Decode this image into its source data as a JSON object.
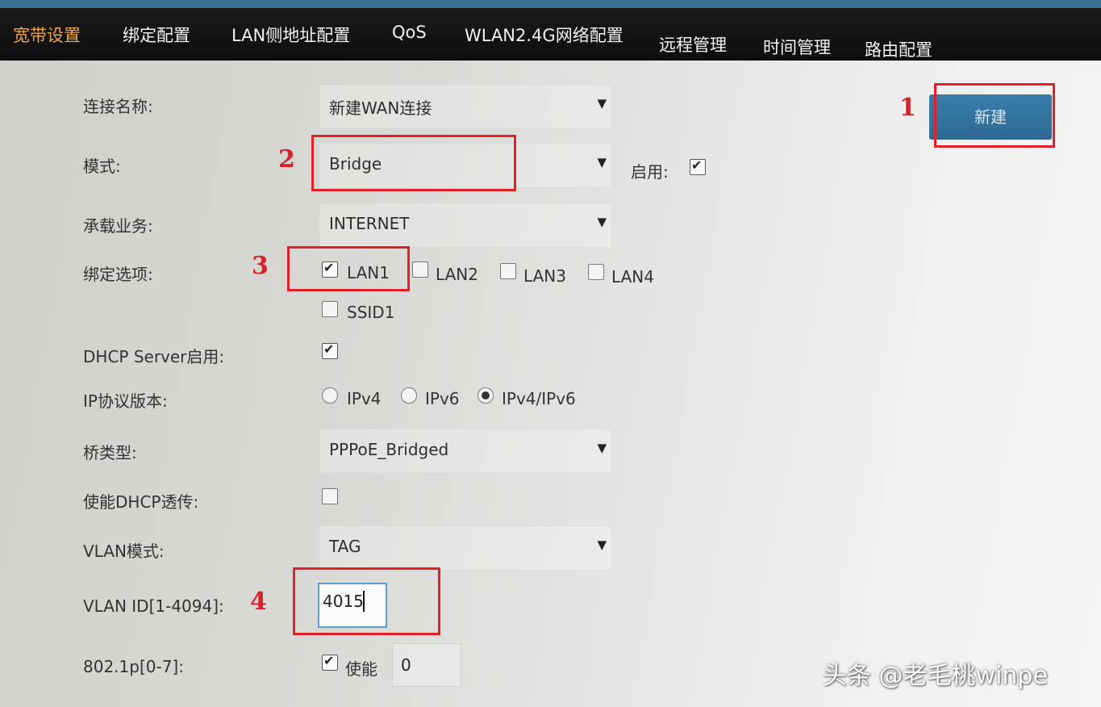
{
  "navbar": {
    "items": [
      "宽带设置",
      "绑定配置",
      "LAN侧地址配置",
      "QoS",
      "WLAN2.4G网络配置",
      "远程管理",
      "时间管理",
      "路由配置"
    ],
    "active_index": 0
  },
  "form": {
    "connection_name": {
      "label": "连接名称:",
      "value": "新建WAN连接"
    },
    "mode": {
      "label": "模式:",
      "value": "Bridge",
      "enable_label": "启用:",
      "enabled": true
    },
    "service": {
      "label": "承载业务:",
      "value": "INTERNET"
    },
    "bind": {
      "label": "绑定选项:",
      "options": [
        {
          "label": "LAN1",
          "checked": true
        },
        {
          "label": "LAN2",
          "checked": false
        },
        {
          "label": "LAN3",
          "checked": false
        },
        {
          "label": "LAN4",
          "checked": false
        },
        {
          "label": "SSID1",
          "checked": false
        }
      ]
    },
    "dhcp_server": {
      "label": "DHCP Server启用:",
      "checked": true
    },
    "ip_version": {
      "label": "IP协议版本:",
      "options": [
        "IPv4",
        "IPv6",
        "IPv4/IPv6"
      ],
      "selected": "IPv4/IPv6"
    },
    "bridge_type": {
      "label": "桥类型:",
      "value": "PPPoE_Bridged"
    },
    "dhcp_passthrough": {
      "label": "使能DHCP透传:",
      "checked": false
    },
    "vlan_mode": {
      "label": "VLAN模式:",
      "value": "TAG"
    },
    "vlan_id": {
      "label": "VLAN ID[1-4094]:",
      "value": "4015"
    },
    "priority": {
      "label": "802.1p[0-7]:",
      "enable_label": "使能",
      "enabled": true,
      "value": "0"
    }
  },
  "new_button": {
    "label": "新建"
  },
  "markers": [
    "1",
    "2",
    "3",
    "4"
  ],
  "watermark": "头条 @老毛桃winpe",
  "colors": {
    "accent": "#2f6a93",
    "nav_active": "#f0a640",
    "annotation_red": "#e2202a"
  }
}
